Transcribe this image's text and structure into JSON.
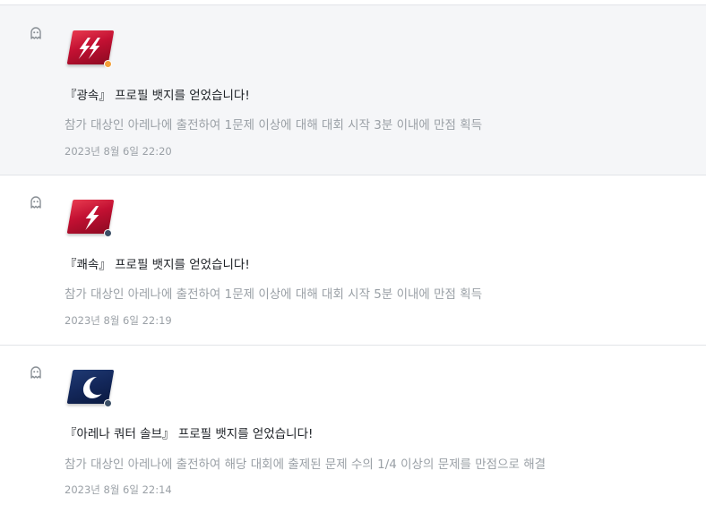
{
  "notifications": [
    {
      "title": "『광속』 프로필 뱃지를 얻었습니다!",
      "description": "참가 대상인 아레나에 출전하여 1문제 이상에 대해 대회 시작 3분 이내에 만점 획득",
      "time": "2023년 8월 6일 22:20",
      "type_icon": "ghost-icon",
      "badge_icon": "double-lightning-icon",
      "badge_color": "#c21032",
      "dot_color": "#f2a03a"
    },
    {
      "title": "『쾌속』 프로필 뱃지를 얻었습니다!",
      "description": "참가 대상인 아레나에 출전하여 1문제 이상에 대해 대회 시작 5분 이내에 만점 획득",
      "time": "2023년 8월 6일 22:19",
      "type_icon": "ghost-icon",
      "badge_icon": "lightning-icon",
      "badge_color": "#c21032",
      "dot_color": "#3b4f66"
    },
    {
      "title": "『아레나 쿼터 솔브』 프로필 뱃지를 얻었습니다!",
      "description": "참가 대상인 아레나에 출전하여 해당 대회에 출제된 문제 수의 1/4 이상의 문제를 만점으로 해결",
      "time": "2023년 8월 6일 22:14",
      "type_icon": "ghost-icon",
      "badge_icon": "crescent-moon-icon",
      "badge_color": "#13275a",
      "dot_color": "#3b4f66"
    }
  ],
  "colors": {
    "highlight_background": "#f5f6f8",
    "divider": "#e2e4e8",
    "title_text": "#1b1f24",
    "muted_text": "#9aa0a6"
  }
}
